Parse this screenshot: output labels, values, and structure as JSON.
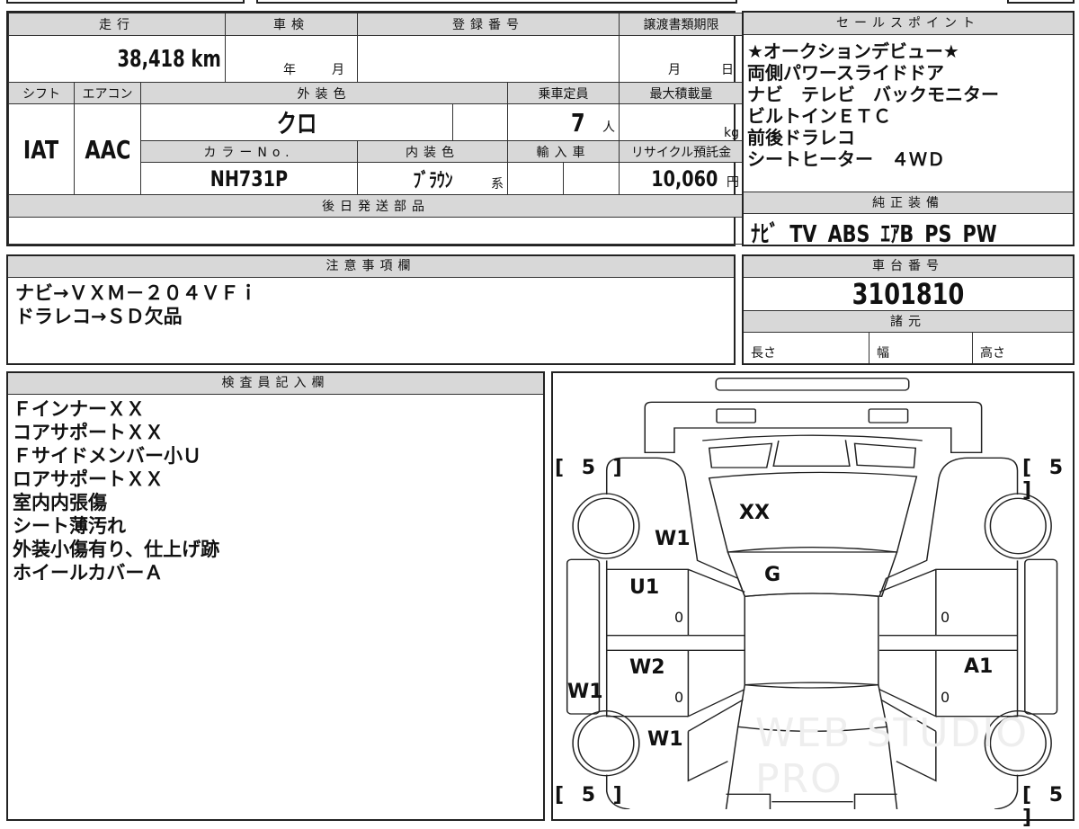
{
  "main_table": {
    "headers": {
      "mileage": "走行",
      "inspection": "車検",
      "registration": "登録番号",
      "transfer_deadline": "譲渡書類期限",
      "shift": "シフト",
      "aircon": "エアコン",
      "exterior_color": "外装色",
      "capacity": "乗車定員",
      "max_load": "最大積載量",
      "color_no": "カラーNo.",
      "interior_color": "内装色",
      "imported": "輸入車",
      "recycle_fee": "リサイクル預託金",
      "later_parts": "後日発送部品"
    },
    "mileage": "38,418 km",
    "inspection_year": "年",
    "inspection_month": "月",
    "deadline_month": "月",
    "deadline_day": "日",
    "shift": "IAT",
    "aircon": "AAC",
    "exterior_color": "クロ",
    "capacity": "7",
    "capacity_unit": "人",
    "max_load_unit": "kg",
    "color_no": "NH731P",
    "interior_color": "ﾌﾞﾗｳﾝ",
    "interior_suffix": "系",
    "recycle_fee": "10,060",
    "recycle_unit": "円"
  },
  "sales_points": {
    "header": "セールスポイント",
    "lines": [
      "★オークションデビュー★",
      "両側パワースライドドア",
      "ナビ　テレビ　バックモニター",
      "ビルトインＥＴＣ",
      "前後ドラレコ",
      "シートヒーター　４ＷＤ"
    ]
  },
  "equipment": {
    "header": "純正装備",
    "value": "ﾅﾋﾞ TV ABS ｴｱB PS PW"
  },
  "notes": {
    "header": "注意事項欄",
    "lines": [
      "ナビ→ＶＸＭ－２０４ＶＦｉ",
      "ドラレコ→ＳＤ欠品"
    ]
  },
  "chassis": {
    "header": "車台番号",
    "value": "3101810",
    "spec_header": "諸元",
    "length": "長さ",
    "width": "幅",
    "height": "高さ"
  },
  "inspector": {
    "header": "検査員記入欄",
    "lines": [
      "ＦインナーＸＸ",
      "コアサポートＸＸ",
      "Ｆサイドメンバー小Ｕ",
      "ロアサポートＸＸ",
      "室内内張傷",
      "シート薄汚れ",
      "外装小傷有り、仕上げ跡",
      "ホイールカバーＡ"
    ]
  },
  "diagram": {
    "tread": "[ 5 ]",
    "marks": {
      "windshield": "XX",
      "front_fender_left": "W1",
      "roof_front": "G",
      "front_door_left": "U1",
      "rear_door_left": "W2",
      "sill_left": "W1",
      "rear_fender_left": "W1",
      "rear_door_right": "A1",
      "zero": "0"
    },
    "watermark": "WEB STUDIO PRO"
  }
}
